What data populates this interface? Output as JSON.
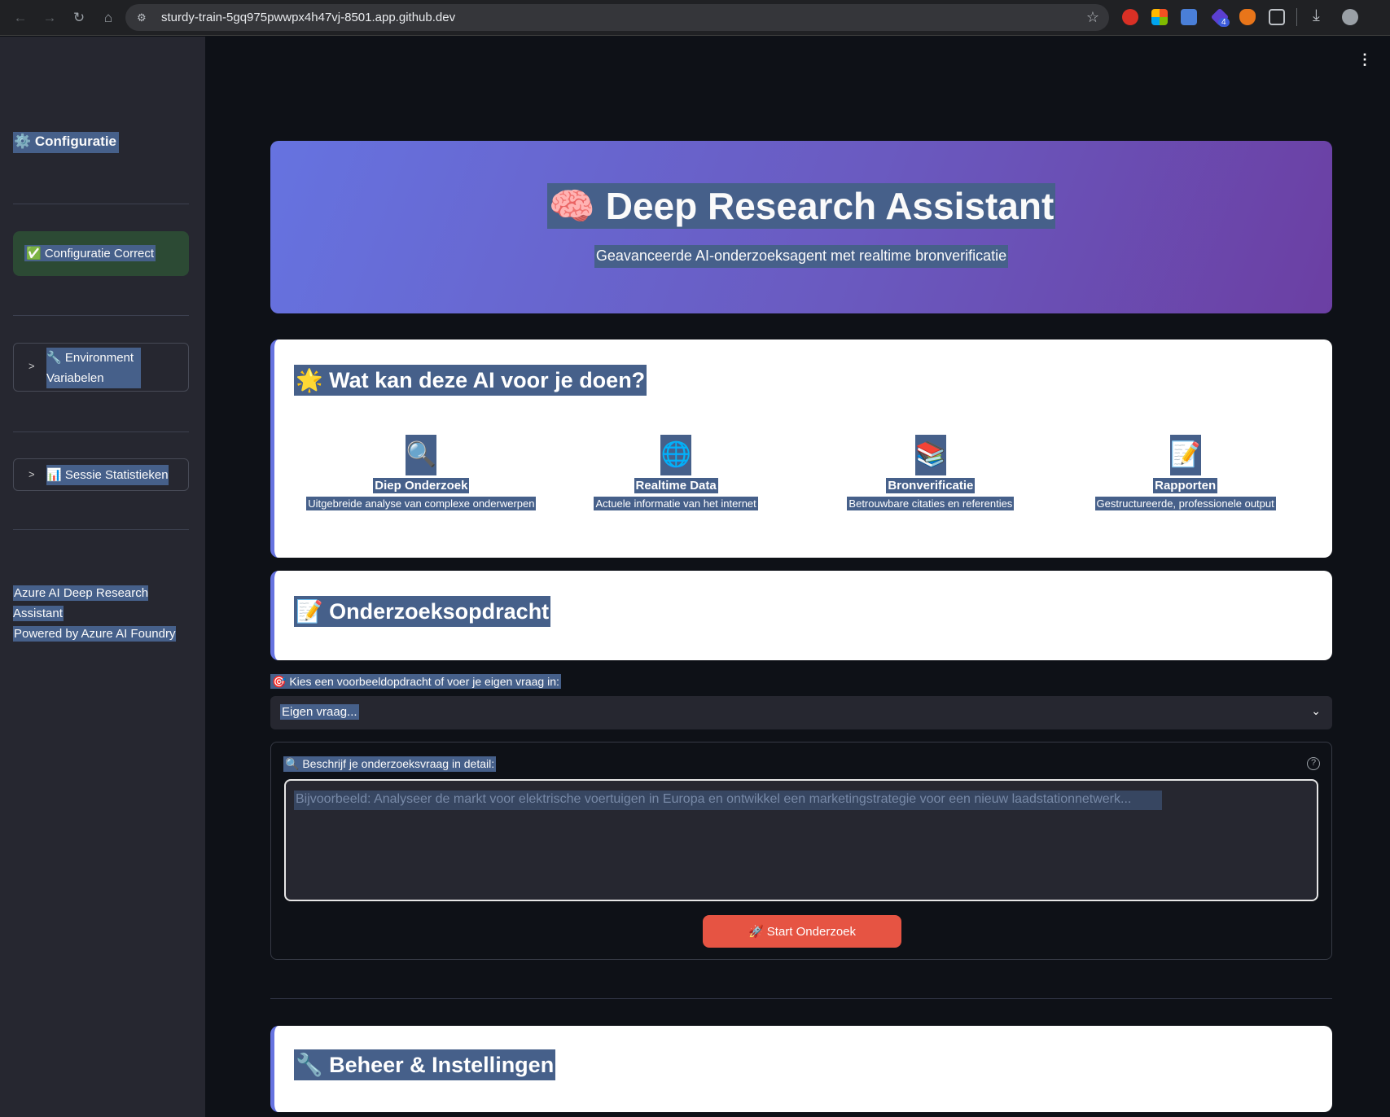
{
  "browser": {
    "url": "sturdy-train-5gq975pwwpx4h47vj-8501.app.github.dev",
    "ext_badge": "4"
  },
  "sidebar": {
    "title": "⚙️ Configuratie",
    "status": "✅ Configuratie Correct",
    "expanders": [
      {
        "label": "🔧 Environment Variabelen"
      },
      {
        "label": "📊 Sessie Statistieken"
      }
    ],
    "footer_line1": "Azure AI Deep Research Assistant",
    "footer_line2": "Powered by Azure AI Foundry"
  },
  "hero": {
    "title": "🧠 Deep Research Assistant",
    "subtitle": "Geavanceerde AI-onderzoeksagent met realtime bronverificatie"
  },
  "capabilities": {
    "heading": "🌟 Wat kan deze AI voor je doen?",
    "items": [
      {
        "icon": "🔍",
        "title": "Diep Onderzoek",
        "desc": "Uitgebreide analyse van complexe onderwerpen"
      },
      {
        "icon": "🌐",
        "title": "Realtime Data",
        "desc": "Actuele informatie van het internet"
      },
      {
        "icon": "📚",
        "title": "Bronverificatie",
        "desc": "Betrouwbare citaties en referenties"
      },
      {
        "icon": "📝",
        "title": "Rapporten",
        "desc": "Gestructureerde, professionele output"
      }
    ]
  },
  "assignment": {
    "heading": "📝 Onderzoeksopdracht",
    "select_label": "🎯 Kies een voorbeeldopdracht of voer je eigen vraag in:",
    "select_value": "Eigen vraag...",
    "textarea_label": "🔍 Beschrijf je onderzoeksvraag in detail:",
    "textarea_placeholder": "Bijvoorbeeld: Analyseer de markt voor elektrische voertuigen in Europa en ontwikkel een marketingstrategie voor een nieuw laadstationnetwerk...",
    "start_button": "🚀 Start Onderzoek"
  },
  "management": {
    "heading": "🔧 Beheer & Instellingen"
  }
}
